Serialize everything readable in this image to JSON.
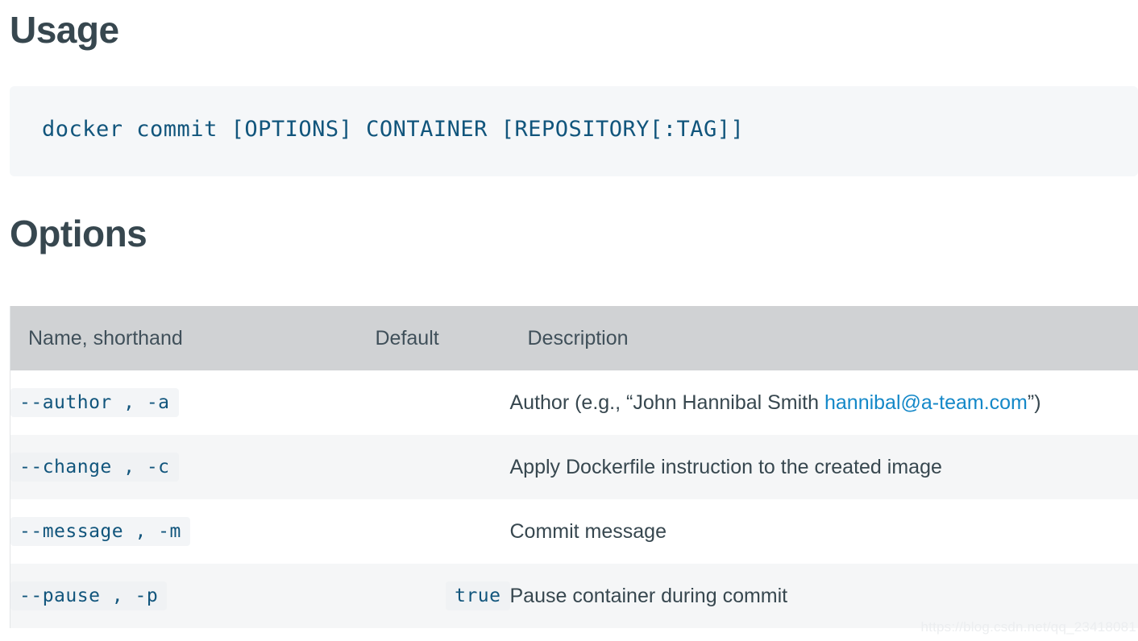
{
  "usage": {
    "heading": "Usage",
    "command": "docker commit [OPTIONS] CONTAINER [REPOSITORY[:TAG]]"
  },
  "options": {
    "heading": "Options",
    "table": {
      "columns": [
        {
          "key": "name",
          "label": "Name, shorthand"
        },
        {
          "key": "default",
          "label": "Default"
        },
        {
          "key": "description",
          "label": "Description"
        }
      ],
      "rows": [
        {
          "name": "--author , -a",
          "default": "",
          "description_prefix": "Author (e.g., “John Hannibal Smith ",
          "description_link": "hannibal@a-team.com",
          "description_suffix": "”)"
        },
        {
          "name": "--change , -c",
          "default": "",
          "description_prefix": "Apply Dockerfile instruction to the created image",
          "description_link": "",
          "description_suffix": ""
        },
        {
          "name": "--message , -m",
          "default": "",
          "description_prefix": "Commit message",
          "description_link": "",
          "description_suffix": ""
        },
        {
          "name": "--pause , -p",
          "default": "true",
          "description_prefix": "Pause container during commit",
          "description_link": "",
          "description_suffix": ""
        }
      ]
    }
  },
  "watermark": {
    "text": "https://blog.csdn.net/qq_23418081"
  },
  "colors": {
    "heading": "#37474f",
    "code_text": "#11557c",
    "code_bg": "#f5f7f9",
    "table_header_bg": "#d0d2d4",
    "row_stripe_bg": "#f5f6f7",
    "link": "#1488c8"
  }
}
